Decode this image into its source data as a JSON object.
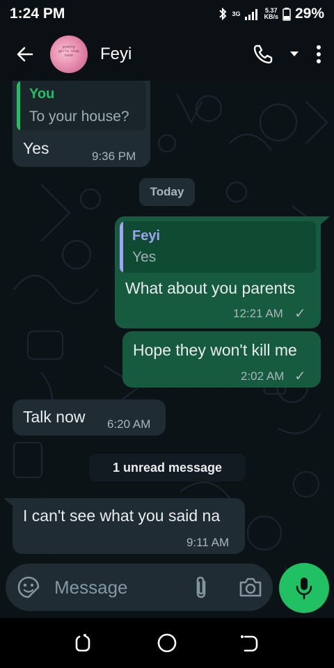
{
  "status": {
    "time": "1:24 PM",
    "network": "3G",
    "speed_value": "5.37",
    "speed_unit": "KB/s",
    "battery": "29%"
  },
  "header": {
    "contact_name": "Feyi",
    "avatar_text": "pretty girls stay hate",
    "icons": [
      "back-arrow-icon",
      "phone-icon",
      "dropdown-icon",
      "more-vertical-icon"
    ]
  },
  "chat": {
    "messages": [
      {
        "direction": "in",
        "quote_author": "You",
        "quote_text": "To your house?",
        "text": "Yes",
        "time": "9:36 PM"
      },
      {
        "direction": "divider",
        "text": "Today"
      },
      {
        "direction": "out",
        "quote_author": "Feyi",
        "quote_text": "Yes",
        "text": "What about you parents",
        "time": "12:21 AM",
        "status": "✓"
      },
      {
        "direction": "out",
        "text": "Hope they won't kill me",
        "time": "2:02 AM",
        "status": "✓"
      },
      {
        "direction": "in",
        "text": "Talk now",
        "time": "6:20 AM"
      },
      {
        "direction": "divider",
        "text": "1 unread message"
      },
      {
        "direction": "in",
        "text": "I can't see what you said na",
        "time": "9:11 AM"
      }
    ]
  },
  "input": {
    "placeholder": "Message",
    "icons": [
      "sticker-icon",
      "attachment-icon",
      "camera-icon",
      "microphone-icon"
    ]
  },
  "navbar": {
    "icons": [
      "recent-apps-icon",
      "home-icon",
      "back-icon"
    ]
  },
  "colors": {
    "background": "#0c1317",
    "incoming_bubble": "#1f2c34",
    "outgoing_bubble": "#165a3f",
    "accent_green": "#21c063",
    "quote_you": "#53bdeb",
    "quote_feyi": "#a5a1f7"
  }
}
